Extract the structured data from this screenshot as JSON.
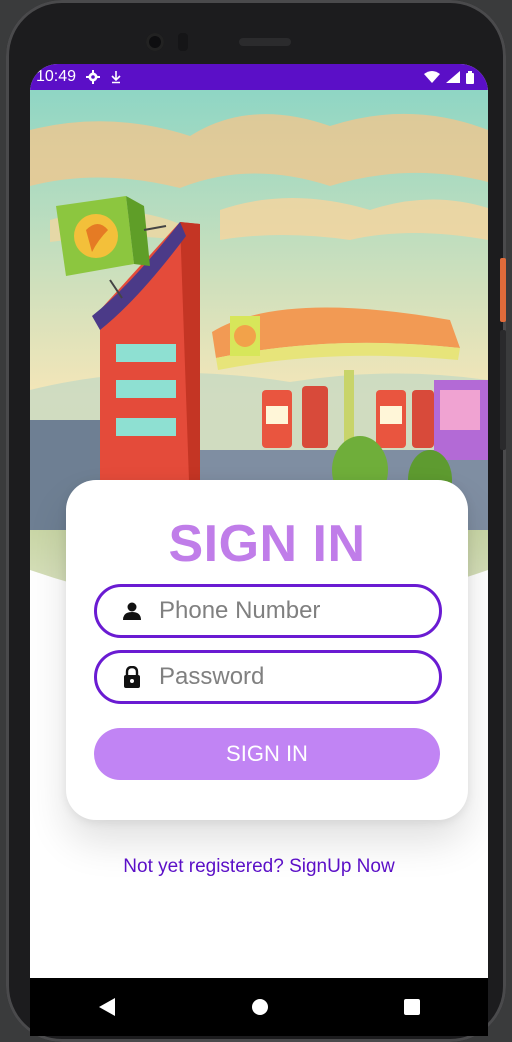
{
  "status_bar": {
    "time": "10:49",
    "left_icons": [
      "settings-icon",
      "download-icon"
    ],
    "right_icons": [
      "wifi-icon",
      "signal-icon",
      "battery-icon"
    ],
    "color": "#5b0fc7"
  },
  "hero": {
    "image": "cartoon-gas-station-illustration"
  },
  "sign_in_card": {
    "title": "SIGN IN",
    "phone_field": {
      "placeholder": "Phone Number",
      "value": "",
      "icon": "person-icon"
    },
    "password_field": {
      "placeholder": "Password",
      "value": "",
      "icon": "lock-icon"
    },
    "submit_label": "SIGN IN"
  },
  "signup_link": "Not yet registered? SignUp Now",
  "nav_bar": {
    "buttons": [
      "back-icon",
      "home-icon",
      "recents-icon"
    ]
  },
  "colors": {
    "accent": "#5b0fc7",
    "title": "#c07de9",
    "button": "#c184f4",
    "field_border": "#6a1bd2"
  }
}
